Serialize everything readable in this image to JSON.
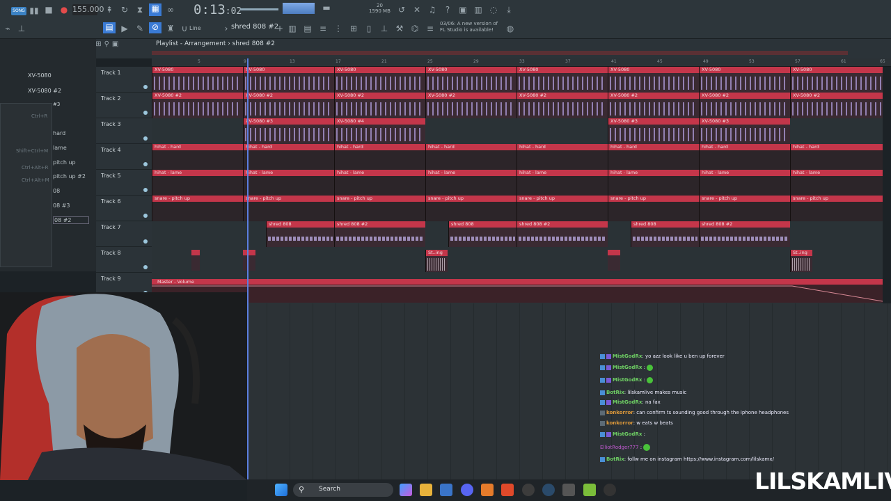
{
  "toolbar": {
    "tempo": "155.000",
    "time_main": "0:13",
    "time_sub": ":02",
    "cpu_mem": "1590 MB",
    "cpu_val": "20",
    "news_line1": "03/06: A new version of",
    "news_line2": "FL Studio is available!",
    "pattern": "shred 808 #2",
    "line_mode": "Line",
    "song_badge": "SONG"
  },
  "breadcrumb": "Playlist - Arrangement › shred 808 #2",
  "browser": {
    "items": [
      "XV-5080",
      "XV-5080 #2",
      "#3",
      "hard",
      "lame",
      "pitch up",
      "pitch up #2",
      "08",
      "08 #3",
      "08 #2"
    ],
    "shortcuts": [
      "Ctrl+R",
      "Shift+Ctrl+M",
      "Ctrl+Alt+R",
      "Ctrl+Alt+M"
    ]
  },
  "ruler": [
    "5",
    "9",
    "13",
    "17",
    "21",
    "25",
    "29",
    "33",
    "37",
    "41",
    "45",
    "49",
    "53",
    "57",
    "61",
    "65"
  ],
  "tracks": [
    "Track 1",
    "Track 2",
    "Track 3",
    "Track 4",
    "Track 5",
    "Track 6",
    "Track 7",
    "Track 8",
    "Track 9"
  ],
  "clip_names": {
    "t1": "XV-5080",
    "t2": "XV-5080 #2",
    "t3a": "XV-5080 #3",
    "t3b": "XV-5080 #4",
    "t4": "hihat - hard",
    "t5": "hihat - lame",
    "t6": "snare - pitch up",
    "t7a": "shred 808",
    "t7b": "shred 808 #2",
    "t8": "St..ing",
    "t9": "Master - Volume"
  },
  "chat": [
    {
      "user": "MistGodRx",
      "text": ": yo azz look like u ben up forever",
      "color": "#6fd064"
    },
    {
      "user": "MistGodRx",
      "text": " :",
      "color": "#6fd064"
    },
    {
      "user": "MistGodRx",
      "text": " :",
      "color": "#6fd064"
    },
    {
      "user": "BotRix",
      "text": ": lilskamlive makes music",
      "color": "#6fd064"
    },
    {
      "user": "MistGodRx",
      "text": ": na fax",
      "color": "#6fd064"
    },
    {
      "user": "konkorror",
      "text": ": can confirm ts sounding good through the iphone headphones",
      "color": "#e09a3a"
    },
    {
      "user": "konkorror",
      "text": ": w eats w beats",
      "color": "#e09a3a"
    },
    {
      "user": "MistGodRx",
      "text": " :",
      "color": "#6fd064"
    },
    {
      "user": "ElliotRodger777",
      "text": " :",
      "color": "#c05ad0"
    },
    {
      "user": "BotRix",
      "text": ": follw me on instagram https://www.instagram.com/lilskamx/",
      "color": "#6fd064"
    }
  ],
  "taskbar": {
    "search": "Search"
  },
  "watermark": "LILSKAMLIVE"
}
